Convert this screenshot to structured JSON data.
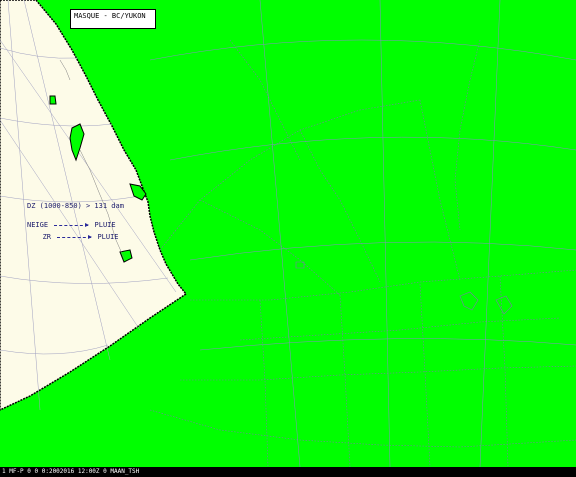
{
  "map": {
    "title": "MASQUE - BC/YUKON",
    "colors": {
      "mask": "#00ff00",
      "land": "#fdfbe8",
      "border": "#000000",
      "gridline": "#8a8ac8",
      "boundary": "#7a7aaa"
    },
    "legend": {
      "criterion": "DZ (1000-850) > 131 dam",
      "rules": [
        {
          "from": "NEIGE",
          "to": "PLUIE"
        },
        {
          "from": "ZR",
          "to": "PLUIE"
        }
      ]
    }
  },
  "status_bar": {
    "text": "1  MF-P  0  0  0:2002016 12:00Z  0  MAAN_TSH"
  }
}
